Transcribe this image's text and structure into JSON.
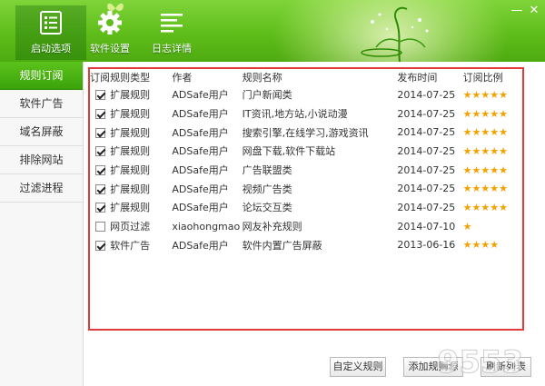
{
  "header": {
    "nav": [
      {
        "label": "启动选项",
        "icon": "checklist-icon"
      },
      {
        "label": "软件设置",
        "icon": "gear-icon"
      },
      {
        "label": "日志详情",
        "icon": "log-lines-icon"
      }
    ],
    "window_controls": {
      "minimize": "—",
      "close": "✕"
    }
  },
  "sidebar": {
    "items": [
      {
        "label": "规则订阅",
        "active": true
      },
      {
        "label": "软件广告",
        "active": false
      },
      {
        "label": "域名屏蔽",
        "active": false
      },
      {
        "label": "排除网站",
        "active": false
      },
      {
        "label": "过滤进程",
        "active": false
      }
    ]
  },
  "table": {
    "columns": [
      "订阅",
      "规则类型",
      "作者",
      "规则名称",
      "发布时间",
      "订阅比例"
    ],
    "rows": [
      {
        "checked": true,
        "type": "扩展规则",
        "author": "ADSafe用户",
        "name": "门户新闻类",
        "date": "2014-07-25",
        "stars": "★★★★★"
      },
      {
        "checked": true,
        "type": "扩展规则",
        "author": "ADSafe用户",
        "name": "IT资讯,地方站,小说动漫",
        "date": "2014-07-25",
        "stars": "★★★★★"
      },
      {
        "checked": true,
        "type": "扩展规则",
        "author": "ADSafe用户",
        "name": "搜索引擎,在线学习,游戏资讯",
        "date": "2014-07-25",
        "stars": "★★★★★"
      },
      {
        "checked": true,
        "type": "扩展规则",
        "author": "ADSafe用户",
        "name": "网盘下载,软件下载站",
        "date": "2014-07-25",
        "stars": "★★★★★"
      },
      {
        "checked": true,
        "type": "扩展规则",
        "author": "ADSafe用户",
        "name": "广告联盟类",
        "date": "2014-07-25",
        "stars": "★★★★★"
      },
      {
        "checked": true,
        "type": "扩展规则",
        "author": "ADSafe用户",
        "name": "视频广告类",
        "date": "2014-07-25",
        "stars": "★★★★★"
      },
      {
        "checked": true,
        "type": "扩展规则",
        "author": "ADSafe用户",
        "name": "论坛交互类",
        "date": "2014-07-25",
        "stars": "★★★★★"
      },
      {
        "checked": false,
        "type": "网页过滤",
        "author": "xiaohongmao",
        "name": "网友补充规则",
        "date": "2014-07-10",
        "stars": "★"
      },
      {
        "checked": true,
        "type": "软件广告",
        "author": "ADSafe用户",
        "name": "软件内置广告屏蔽",
        "date": "2013-06-16",
        "stars": "★★★★"
      }
    ]
  },
  "buttons": {
    "custom_rule": "自定义规则",
    "add_source": "添加规则源",
    "refresh_list": "刷新列表"
  },
  "watermark": "9553",
  "colors": {
    "header_green": "#5fbd1a",
    "active_green": "#3aa30a",
    "highlight_border": "#e33b3b",
    "star": "#f2a200"
  }
}
